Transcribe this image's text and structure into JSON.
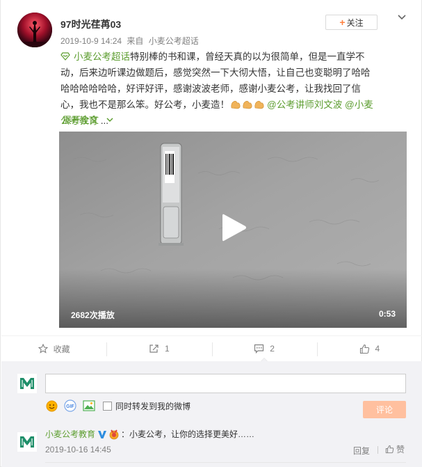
{
  "post": {
    "username": "97时光荏苒03",
    "timestamp": "2019-10-9 14:24",
    "source_prefix": "来自",
    "source": "小麦公考超话",
    "follow_label": "关注",
    "topic": "小麦公考超话",
    "text_main": "特别棒的书和课，曾经天真的以为很简单，但是一直学不动，后来边听课边做题后，感觉突然一下大彻大悟，让自己也变聪明了哈哈哈哈哈哈哈哈，好评好评，感谢波波老师，感谢小麦公考，让我找回了信心，我也不是那么笨。好公考，小麦造！",
    "mention1": "@公考讲师刘文波",
    "mention2": "@小麦公考教育",
    "ellipsis": "...",
    "expand_label": "展开全文",
    "expand_icon": "chevron-down-icon"
  },
  "video": {
    "play_count": "2682次播放",
    "duration": "0:53"
  },
  "actions": {
    "favorite_label": "收藏",
    "repost_count": "1",
    "comment_count": "2",
    "like_count": "4"
  },
  "comment_box": {
    "input_value": "",
    "repost_checkbox_label": "同时转发到我的微博",
    "submit_label": "评论"
  },
  "comments": [
    {
      "author": "小麦公考教育",
      "text": "：小麦公考，让你的选择更美好……",
      "time": "2019-10-16 14:45",
      "reply_label": "回复",
      "like_label": "赞"
    }
  ],
  "colors": {
    "accent_orange": "#eb7350",
    "link_green": "#5c9d2f",
    "submit_disabled": "#ffc09f",
    "verified_blue": "#2e8ddf"
  }
}
